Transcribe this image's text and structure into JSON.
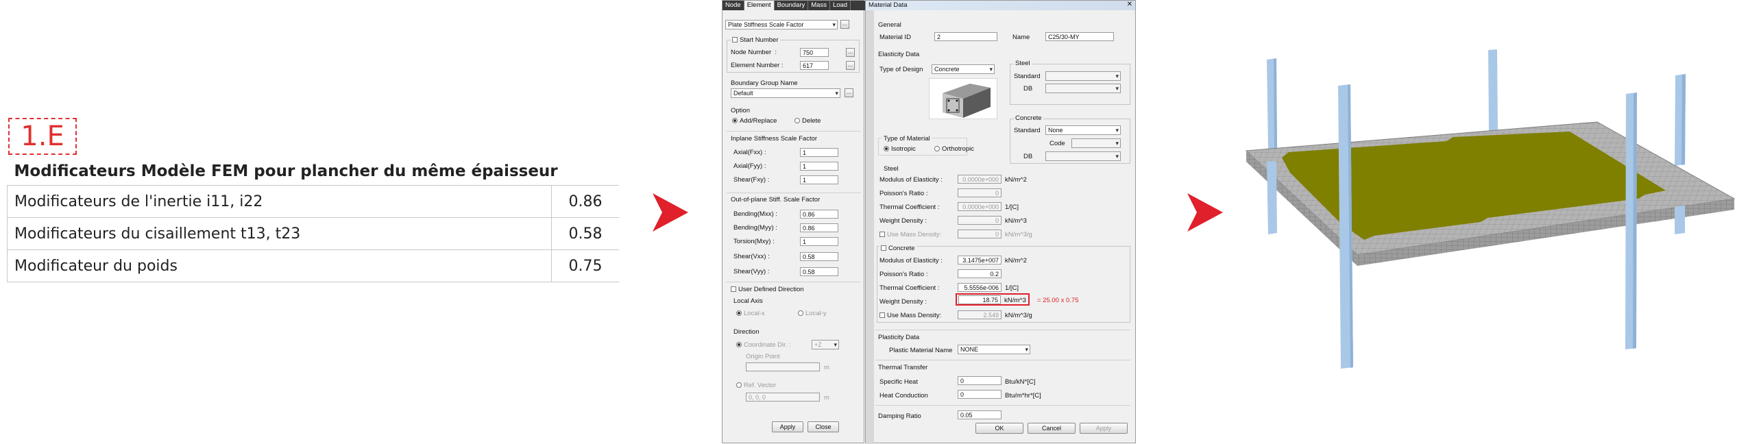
{
  "left_panel": {
    "tag": "1.E",
    "table_title": "Modificateurs Modèle FEM pour plancher du même épaisseur",
    "rows": [
      {
        "label": "Modificateurs de l'inertie i11, i22",
        "value": "0.86"
      },
      {
        "label": "Modificateurs du cisaillement t13, t23",
        "value": "0.58"
      },
      {
        "label": "Modificateur du poids",
        "value": "0.75"
      }
    ]
  },
  "colors": {
    "accent_red": "#e0202a",
    "slab": "#7f7f00",
    "column": "#a9c8e8",
    "mesh": "#a8a8a8"
  },
  "element_dialog": {
    "tabs": [
      "Node",
      "Element",
      "Boundary",
      "Mass",
      "Load"
    ],
    "active_tab": "Element",
    "function_select": "Plate Stiffness Scale Factor",
    "start_number": {
      "title": "Start Number",
      "node_label": "Node Number",
      "node_value": "750",
      "element_label": "Element Number",
      "element_value": "617"
    },
    "boundary_group": {
      "title": "Boundary Group Name",
      "value": "Default"
    },
    "option": {
      "title": "Option",
      "add": "Add/Replace",
      "delete": "Delete"
    },
    "inplane": {
      "title": "Inplane Stiffness Scale Factor",
      "axial_fxx_label": "Axial(Fxx)",
      "axial_fxx": "1",
      "axial_fyy_label": "Axial(Fyy)",
      "axial_fyy": "1",
      "shear_fxy_label": "Shear(Fxy)",
      "shear_fxy": "1"
    },
    "outplane": {
      "title": "Out-of-plane Stiff. Scale Factor",
      "bending_mxx_label": "Bending(Mxx)",
      "bending_mxx": "0.86",
      "bending_myy_label": "Bending(Myy)",
      "bending_myy": "0.86",
      "torsion_mxy_label": "Torsion(Mxy)",
      "torsion_mxy": "1",
      "shear_vxx_label": "Shear(Vxx)",
      "shear_vxx": "0.58",
      "shear_vyy_label": "Shear(Vyy)",
      "shear_vyy": "0.58"
    },
    "user_defined_direction": "User Defined Direction",
    "local_axis": {
      "title": "Local Axis",
      "x": "Local-x",
      "y": "Local-y"
    },
    "direction": {
      "title": "Direction",
      "coord_label": "Coordinate Dir. :",
      "coord_value": "+Z",
      "origin_label": "Origin Point",
      "ref_label": "Ref. Vector",
      "ref_value": "0, 0, 0",
      "unit": "m"
    },
    "apply": "Apply",
    "close": "Close"
  },
  "material_dialog": {
    "title": "Material Data",
    "general": {
      "title": "General",
      "id_label": "Material ID",
      "id_value": "2",
      "name_label": "Name",
      "name_value": "C25/30-MY"
    },
    "elasticity": {
      "title": "Elasticity Data",
      "type_label": "Type of Design",
      "type_value": "Concrete",
      "steel_group": "Steel",
      "standard_label": "Standard",
      "db_label": "DB",
      "concrete_group": "Concrete",
      "concrete_standard": "None",
      "code_label": "Code",
      "material_type_title": "Type of Material",
      "isotropic": "Isotropic",
      "orthotropic": "Orthotropic"
    },
    "steel": {
      "title": "Steel",
      "modulus_label": "Modulus of Elasticity :",
      "modulus_value": "0.0000e+000",
      "modulus_unit": "kN/m^2",
      "poisson_label": "Poisson's Ratio :",
      "poisson_value": "0",
      "thermal_label": "Thermal Coefficient :",
      "thermal_value": "0.0000e+000",
      "thermal_unit": "1/[C]",
      "weight_label": "Weight Density :",
      "weight_value": "0",
      "weight_unit": "kN/m^3",
      "mass_label": "Use Mass Density:",
      "mass_value": "0",
      "mass_unit": "kN/m^3/g"
    },
    "concrete": {
      "title": "Concrete",
      "modulus_label": "Modulus of Elasticity :",
      "modulus_value": "3.1475e+007",
      "modulus_unit": "kN/m^2",
      "poisson_label": "Poisson's Ratio :",
      "poisson_value": "0.2",
      "thermal_label": "Thermal Coefficient :",
      "thermal_value": "5.5556e-006",
      "thermal_unit": "1/[C]",
      "weight_label": "Weight Density :",
      "weight_value": "18.75",
      "weight_unit": "kN/m^3",
      "weight_note": "= 25.00 x 0.75",
      "mass_label": "Use Mass Density:",
      "mass_value": "2.549",
      "mass_unit": "kN/m^3/g"
    },
    "plasticity": {
      "title": "Plasticity Data",
      "label": "Plastic Material Name",
      "value": "NONE"
    },
    "thermal_transfer": {
      "title": "Thermal Transfer",
      "specific_label": "Specific Heat",
      "specific_value": "0",
      "specific_unit": "Btu/kN*[C]",
      "conduction_label": "Heat Conduction",
      "conduction_value": "0",
      "conduction_unit": "Btu/m*hr*[C]"
    },
    "damping_label": "Damping Ratio",
    "damping_value": "0.05",
    "ok": "OK",
    "cancel": "Cancel",
    "apply": "Apply"
  }
}
